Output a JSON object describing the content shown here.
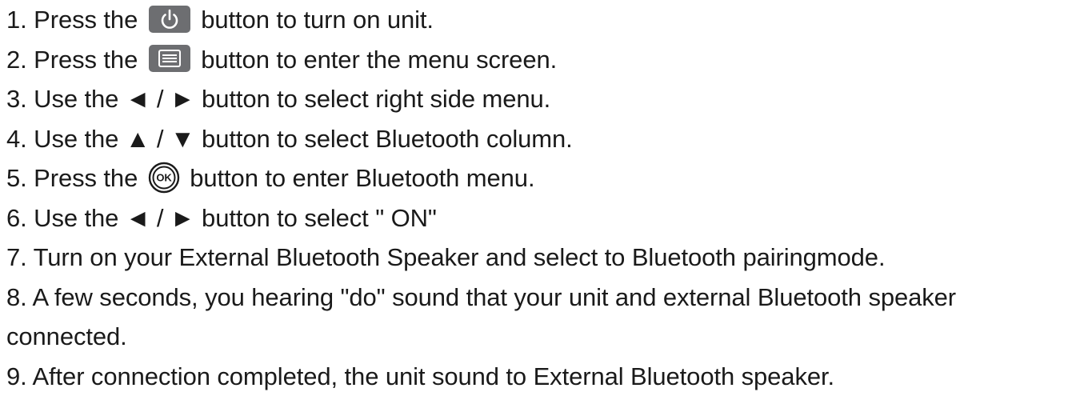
{
  "steps": [
    {
      "prefix": "1. Press the",
      "suffix": "button to turn on unit.",
      "icon": "power-icon"
    },
    {
      "prefix": "2. Press the",
      "suffix": "button to enter the menu screen.",
      "icon": "menu-icon"
    },
    {
      "prefix": "3. Use the",
      "arrows": "◄ / ►",
      "suffix": "button to select right side menu."
    },
    {
      "prefix": "4. Use the",
      "arrows": "▲ / ▼",
      "suffix": " button to select Bluetooth column."
    },
    {
      "prefix": "5. Press the",
      "suffix": "button to enter Bluetooth menu.",
      "icon": "ok-icon",
      "icon_label": "OK"
    },
    {
      "prefix": "6. Use the",
      "arrows": "◄ / ►",
      "suffix": "button to select \" ON\""
    },
    {
      "text": "7. Turn on your External Bluetooth Speaker and select to Bluetooth pairingmode."
    },
    {
      "text": "8. A few seconds, you hearing \"do\" sound that your unit and external Bluetooth speaker"
    },
    {
      "text": "connected."
    },
    {
      "text": "9. After connection completed, the unit sound to External Bluetooth speaker."
    }
  ],
  "colors": {
    "text": "#1a1a1a",
    "icon_fill": "#6d6e71",
    "icon_glyph": "#ffffff"
  }
}
